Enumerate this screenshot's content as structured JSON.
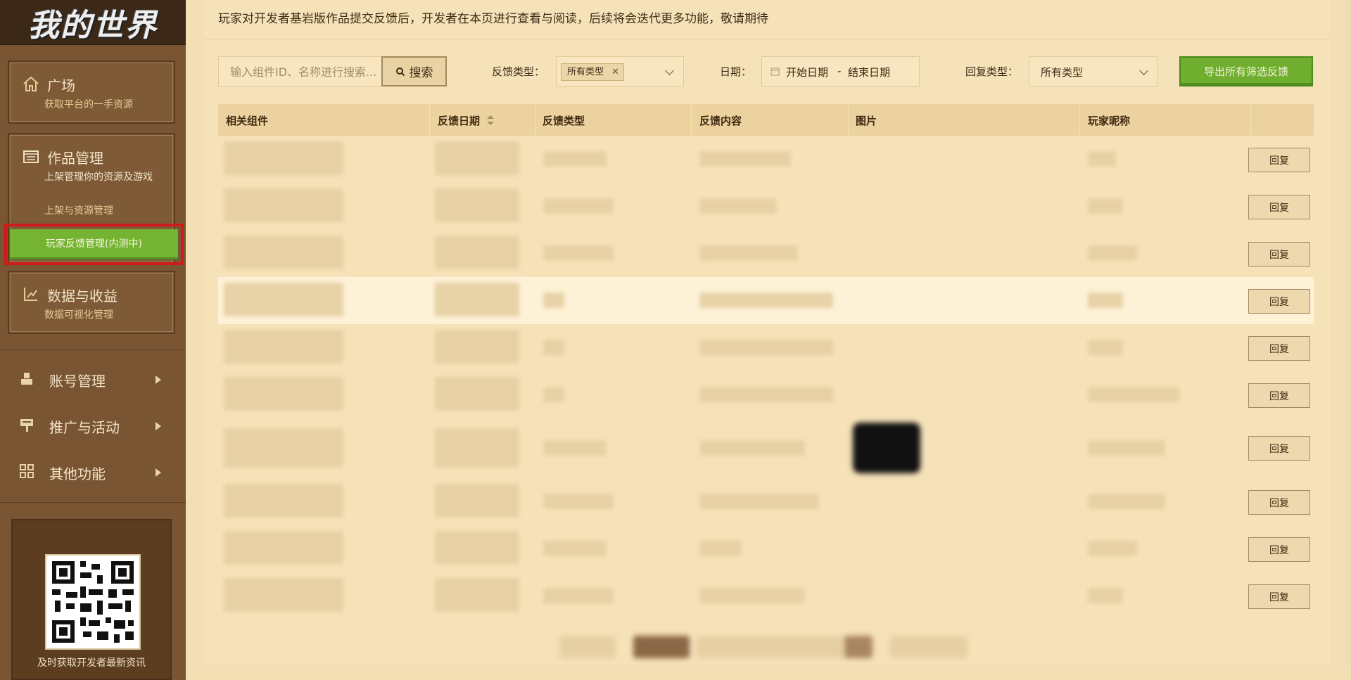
{
  "sidebar": {
    "logo": "我的世界",
    "cards": [
      {
        "title": "广场",
        "sub": "获取平台的一手资源"
      },
      {
        "title": "作品管理",
        "sub": "上架管理你的资源及游戏",
        "items": [
          "上架与资源管理",
          "玩家反馈管理(内测中)"
        ]
      },
      {
        "title": "数据与收益",
        "sub": "数据可视化管理"
      }
    ],
    "nav": [
      {
        "label": "账号管理"
      },
      {
        "label": "推广与活动"
      },
      {
        "label": "其他功能"
      }
    ],
    "qr_text": "及时获取开发者最新资讯"
  },
  "header": {
    "notice": "玩家对开发者基岩版作品提交反馈后，开发者在本页进行查看与阅读，后续将会迭代更多功能，敬请期待"
  },
  "filters": {
    "search_placeholder": "输入组件ID、名称进行搜索...",
    "search_button": "搜索",
    "feedback_type_label": "反馈类型：",
    "feedback_type_tag": "所有类型",
    "date_label": "日期：",
    "date_start": "开始日期",
    "date_sep": "-",
    "date_end": "结束日期",
    "reply_type_label": "回复类型：",
    "reply_type_value": "所有类型",
    "export_button": "导出所有筛选反馈"
  },
  "table": {
    "columns": [
      "相关组件",
      "反馈日期",
      "反馈类型",
      "反馈内容",
      "图片",
      "玩家昵称"
    ],
    "reply_label": "回复"
  },
  "colors": {
    "accent_green": "#6fae2f",
    "sidebar_bg": "#7a5533",
    "main_bg": "#f6e2b9"
  }
}
